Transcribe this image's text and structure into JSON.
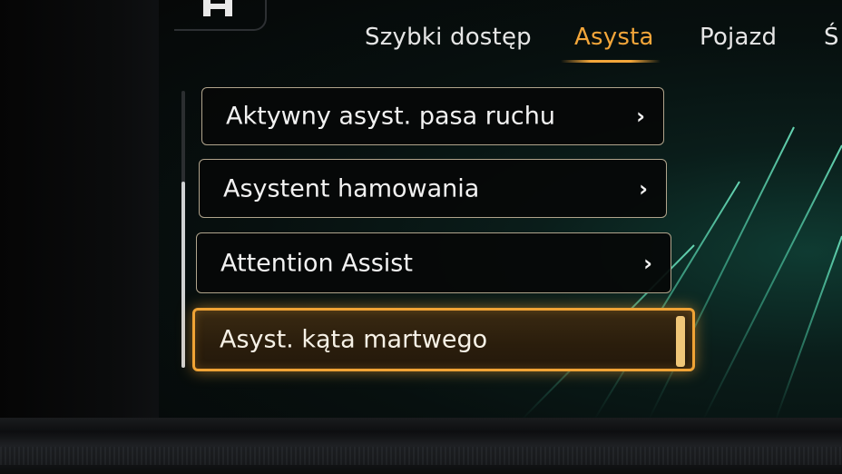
{
  "tabs": [
    {
      "label": "Szybki dostęp",
      "active": false
    },
    {
      "label": "Asysta",
      "active": true
    },
    {
      "label": "Pojazd",
      "active": false
    },
    {
      "label": "Ś",
      "active": false
    }
  ],
  "menu": {
    "items": [
      {
        "label": "Aktywny asyst. pasa ruchu",
        "chevron": "›",
        "selected": false
      },
      {
        "label": "Asystent hamowania",
        "chevron": "›",
        "selected": false
      },
      {
        "label": "Attention Assist",
        "chevron": "›",
        "selected": false
      },
      {
        "label": "Asyst. kąta martwego",
        "selected": true
      }
    ]
  },
  "colors": {
    "accent": "#f3a63a",
    "text": "#f2f2f2",
    "item_border": "#b0a48c",
    "grid": "#4fd6ae"
  },
  "icons": {
    "home": "home-icon",
    "chevron": "chevron-right-icon"
  }
}
